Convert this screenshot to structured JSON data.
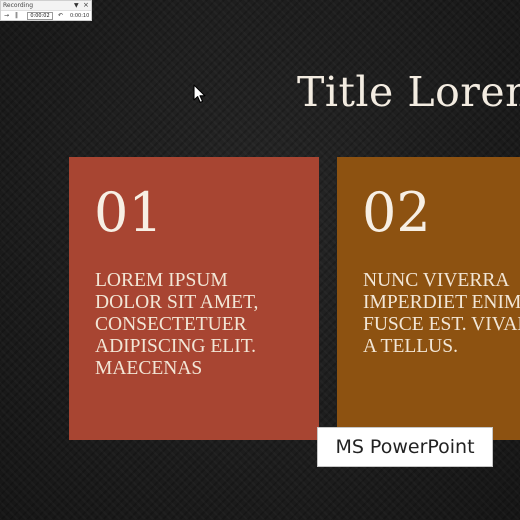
{
  "recording_toolbar": {
    "title": "Recording",
    "dropdown_icon": "▼",
    "close_icon": "×",
    "stop_icon": "→",
    "pause_icon": "‖",
    "elapsed_time": "0:00:02",
    "undo_icon": "↶",
    "total_time": "0:00:10"
  },
  "slide": {
    "title": "Title Lorem Ipsum",
    "cards": [
      {
        "number": "01",
        "text": "LOREM IPSUM\nDOLOR SIT AMET,\nCONSECTETUER\nADIPISCING ELIT.\nMAECENAS",
        "color": "#a84532"
      },
      {
        "number": "02",
        "text": "NUNC VIVERRA\nIMPERDIET ENIM.\nFUSCE EST. VIVAMUS\nA TELLUS.",
        "color": "#8d5211"
      }
    ]
  },
  "app_label": "MS PowerPoint",
  "icons": {
    "cursor": "arrow-cursor-icon"
  }
}
